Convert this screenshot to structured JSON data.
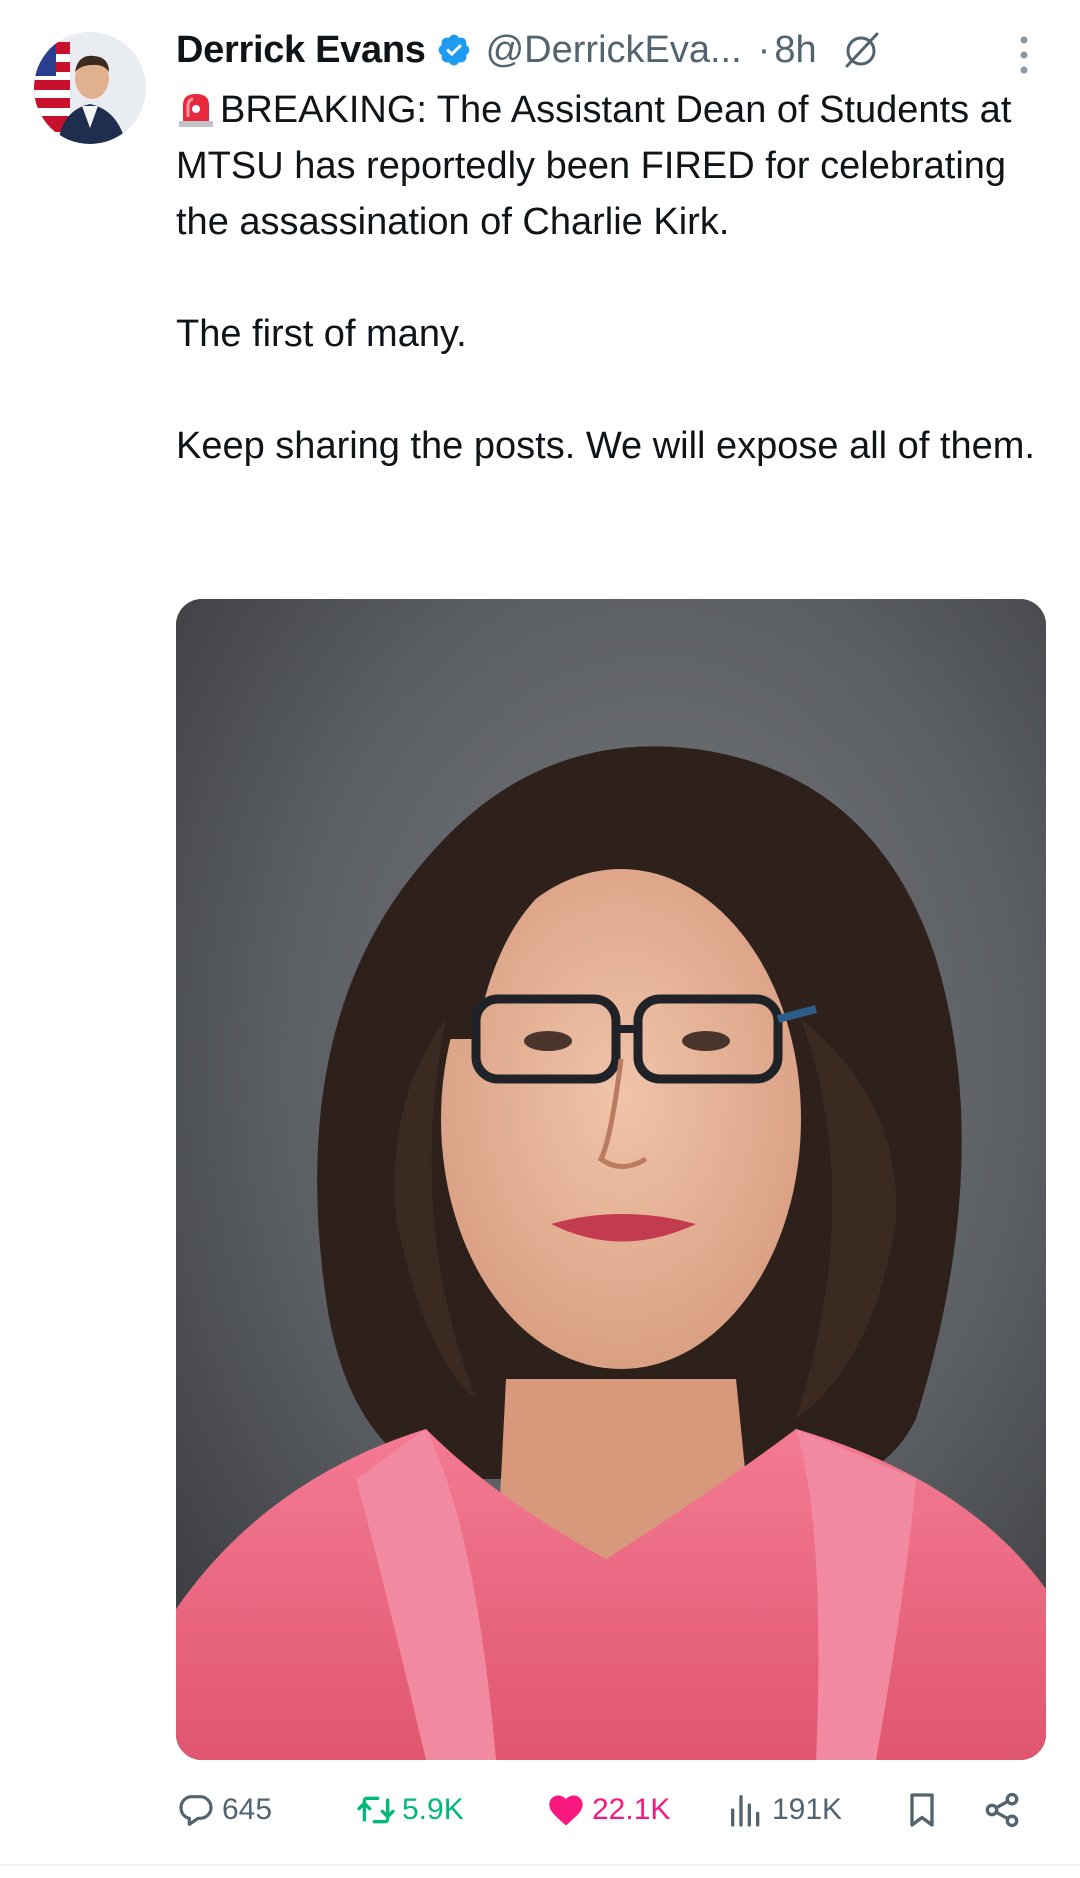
{
  "tweet": {
    "author_name": "Derrick Evans",
    "handle": "@DerrickEva...",
    "separator": "·",
    "time": "8h",
    "paragraphs": [
      "BREAKING: The Assistant Dean of Students at MTSU has reportedly been FIRED for celebrating the assassination of Charlie Kirk.",
      "The first of many.",
      "Keep sharing the posts. We will expose all of them."
    ],
    "media_icon": "siren-emoji"
  },
  "actions": {
    "reply_count": "645",
    "retweet_count": "5.9K",
    "like_count": "22.1K",
    "views_count": "191K"
  },
  "colors": {
    "verified": "#1d9bf0",
    "retweet_active": "#00ba7c",
    "like_active": "#f91880",
    "muted_text": "#536471"
  },
  "icons": [
    "verified-badge-icon",
    "grok-icon",
    "more-options-icon",
    "reply-icon",
    "retweet-icon",
    "like-icon",
    "views-icon",
    "bookmark-icon",
    "share-icon"
  ]
}
